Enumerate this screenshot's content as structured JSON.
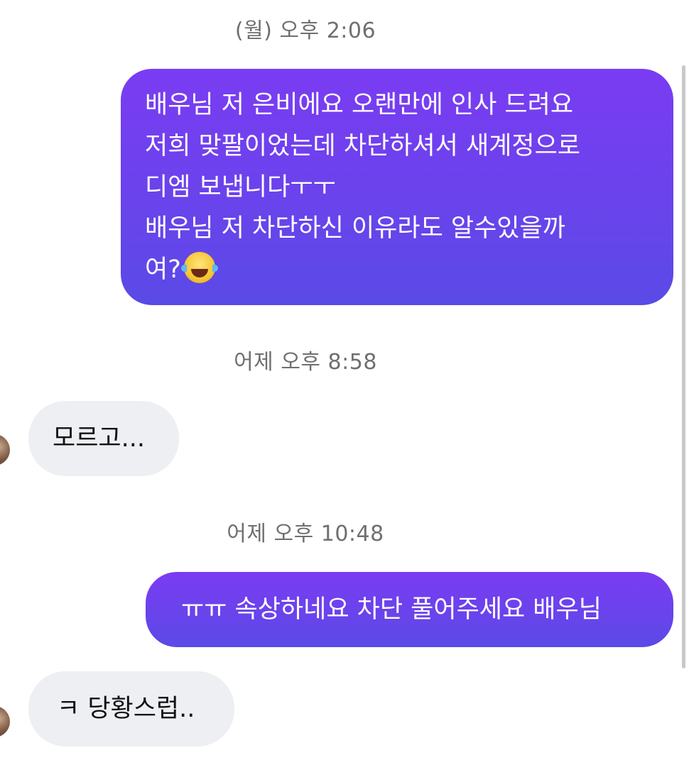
{
  "messages": [
    {
      "type": "timestamp",
      "text": "(월) 오후 2:06"
    },
    {
      "type": "outgoing",
      "lines": [
        "배우님 저 은비에요 오랜만에 인사 드려요",
        "저희 맞팔이었는데 차단하셔서 새계정으로",
        "디엠 보냅니다ㅜㅜ",
        "배우님 저 차단하신 이유라도 알수있을까",
        "여?"
      ],
      "emoji": "face-with-tears-of-joy-icon"
    },
    {
      "type": "timestamp",
      "text": "어제 오후 8:58"
    },
    {
      "type": "incoming",
      "text": "모르고..."
    },
    {
      "type": "timestamp",
      "text": "어제 오후 10:48"
    },
    {
      "type": "outgoing",
      "text": "ㅠㅠ 속상하네요 차단 풀어주세요 배우님"
    },
    {
      "type": "incoming",
      "text": "ㅋ 당황스럽.."
    }
  ],
  "colors": {
    "outgoing_bubble_top": "#7a3cf2",
    "outgoing_bubble_bottom": "#5a4ae6",
    "incoming_bubble": "#eeeff3",
    "timestamp_text": "#6f6f6f"
  }
}
